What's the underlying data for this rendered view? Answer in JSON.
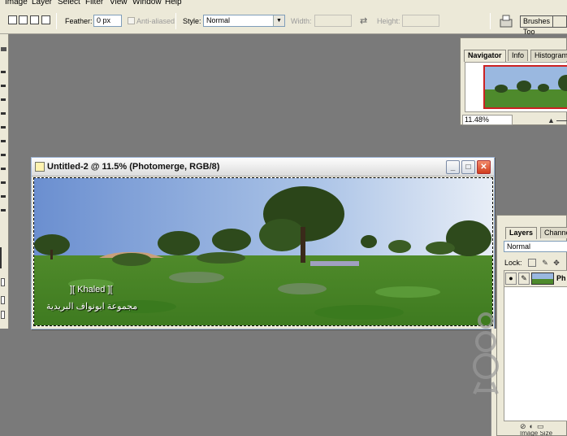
{
  "menubar": {
    "items": [
      "Image",
      "Layer",
      "Select",
      "Filter",
      "View",
      "Window",
      "Help"
    ]
  },
  "options_bar": {
    "feather_label": "Feather:",
    "feather_value": "0 px",
    "anti_aliased_label": "Anti-aliased",
    "style_label": "Style:",
    "style_value": "Normal",
    "width_label": "Width:",
    "height_label": "Height:",
    "palette_tabs": [
      "Brushes",
      "Too"
    ]
  },
  "document": {
    "title": "Untitled-2 @ 11.5% (Photomerge, RGB/8)",
    "minimize_label": "_",
    "maximize_label": "□",
    "close_label": "✕",
    "watermark_line1": "][ Khaled ][",
    "watermark_line2": "مجموعة ابونواف البريدية"
  },
  "navigator": {
    "tabs": [
      "Navigator",
      "Info",
      "Histogram"
    ],
    "zoom_value": "11.48%"
  },
  "layers": {
    "tabs": [
      "Layers",
      "Channe"
    ],
    "blend_mode": "Normal",
    "lock_label": "Lock:",
    "layer_name": "Ph",
    "image_size_tab": "Image Size"
  },
  "icons": {
    "swap": "swap-icon",
    "close": "close-icon",
    "eye": "eye-icon",
    "brush": "brush-icon"
  },
  "colors": {
    "ui_chrome": "#ece9d8",
    "workspace": "#7a7a7a",
    "close_button": "#d03c1c",
    "navigator_view_box": "#cc2222"
  }
}
